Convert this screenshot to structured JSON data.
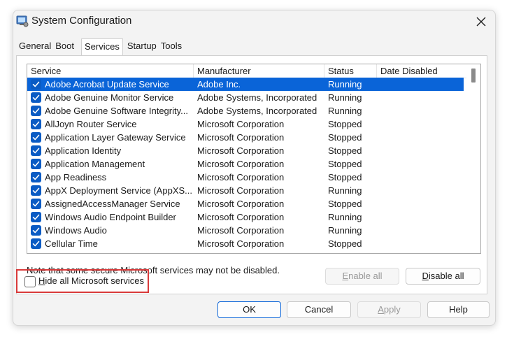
{
  "window": {
    "title": "System Configuration"
  },
  "tabs": [
    {
      "label": "General"
    },
    {
      "label": "Boot"
    },
    {
      "label": "Services",
      "active": true
    },
    {
      "label": "Startup"
    },
    {
      "label": "Tools"
    }
  ],
  "table": {
    "columns": [
      "Service",
      "Manufacturer",
      "Status",
      "Date Disabled"
    ],
    "rows": [
      {
        "service": "Adobe Acrobat Update Service",
        "manufacturer": "Adobe Inc.",
        "status": "Running",
        "date_disabled": "",
        "checked": true,
        "selected": true
      },
      {
        "service": "Adobe Genuine Monitor Service",
        "manufacturer": "Adobe Systems, Incorporated",
        "status": "Running",
        "date_disabled": "",
        "checked": true
      },
      {
        "service": "Adobe Genuine Software Integrity...",
        "manufacturer": "Adobe Systems, Incorporated",
        "status": "Running",
        "date_disabled": "",
        "checked": true
      },
      {
        "service": "AllJoyn Router Service",
        "manufacturer": "Microsoft Corporation",
        "status": "Stopped",
        "date_disabled": "",
        "checked": true
      },
      {
        "service": "Application Layer Gateway Service",
        "manufacturer": "Microsoft Corporation",
        "status": "Stopped",
        "date_disabled": "",
        "checked": true
      },
      {
        "service": "Application Identity",
        "manufacturer": "Microsoft Corporation",
        "status": "Stopped",
        "date_disabled": "",
        "checked": true
      },
      {
        "service": "Application Management",
        "manufacturer": "Microsoft Corporation",
        "status": "Stopped",
        "date_disabled": "",
        "checked": true
      },
      {
        "service": "App Readiness",
        "manufacturer": "Microsoft Corporation",
        "status": "Stopped",
        "date_disabled": "",
        "checked": true
      },
      {
        "service": "AppX Deployment Service (AppXS...",
        "manufacturer": "Microsoft Corporation",
        "status": "Running",
        "date_disabled": "",
        "checked": true
      },
      {
        "service": "AssignedAccessManager Service",
        "manufacturer": "Microsoft Corporation",
        "status": "Stopped",
        "date_disabled": "",
        "checked": true
      },
      {
        "service": "Windows Audio Endpoint Builder",
        "manufacturer": "Microsoft Corporation",
        "status": "Running",
        "date_disabled": "",
        "checked": true
      },
      {
        "service": "Windows Audio",
        "manufacturer": "Microsoft Corporation",
        "status": "Running",
        "date_disabled": "",
        "checked": true
      },
      {
        "service": "Cellular Time",
        "manufacturer": "Microsoft Corporation",
        "status": "Stopped",
        "date_disabled": "",
        "checked": true
      }
    ]
  },
  "note": "Note that some secure Microsoft services may not be disabled.",
  "buttons": {
    "enable_all": "Enable all",
    "disable_all": "Disable all",
    "ok": "OK",
    "cancel": "Cancel",
    "apply": "Apply",
    "help": "Help"
  },
  "hide_ms": {
    "label": "Hide all Microsoft services",
    "checked": false
  },
  "colors": {
    "selection": "#0a64d8",
    "checkbox": "#0a5bc4",
    "highlight_box": "#d93a3a"
  },
  "icons": {
    "app": "msconfig-icon",
    "close": "close-icon",
    "checkbox": "checkmark-icon"
  }
}
